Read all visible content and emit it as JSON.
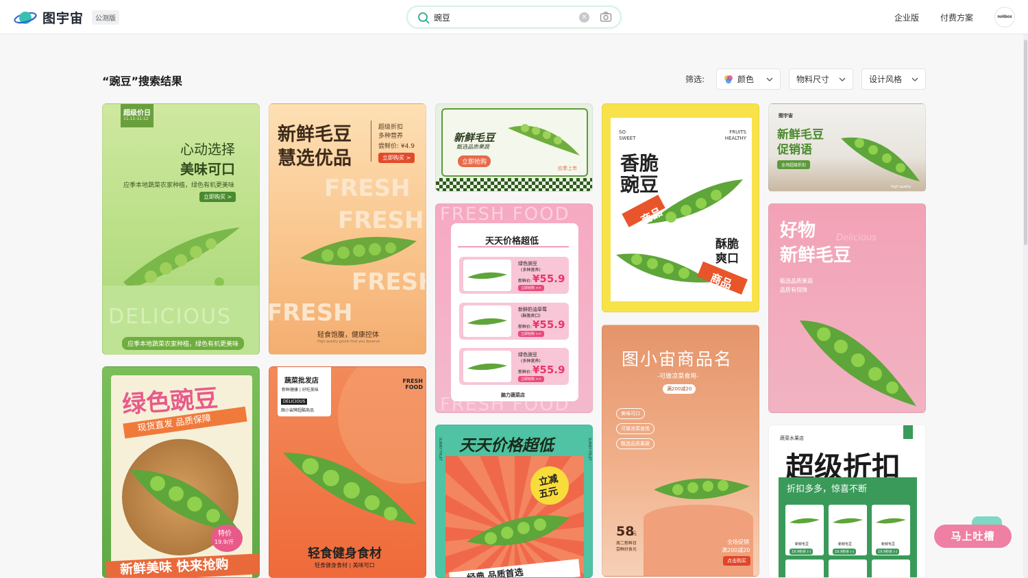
{
  "header": {
    "brand": "图宇宙",
    "edition_badge": "公测版",
    "search": {
      "value": "豌豆",
      "placeholder": ""
    },
    "nav": [
      "企业版",
      "付费方案"
    ],
    "avatar_text": "nolibox"
  },
  "results": {
    "title": "“豌豆”搜索结果",
    "filter_label": "筛选:",
    "filters": [
      "颜色",
      "物料尺寸",
      "设计风格"
    ]
  },
  "cards": {
    "c1": {
      "badge": "超级价日",
      "badge_date": "11.11-11.12",
      "title1": "心动选择",
      "title2": "美味可口",
      "desc": "应季本地蔬菜农家种植，绿色有机更美味",
      "btn": "立即购买 >",
      "watermark": "DELICIOUS",
      "footer": "应季本地蔬菜农家种植，绿色有机更美味"
    },
    "c2": {
      "title1": "新鲜毛豆",
      "title2": "慧选优品",
      "side1": "超级折扣",
      "side2": "多种营养",
      "price": "尝鲜价: ¥4.9",
      "btn": "立即购买 >",
      "fresh": "FRESH",
      "bottom": "轻食饱腹，健康控体",
      "sub": "High quality goods that you deserve."
    },
    "c3": {
      "title": "新鲜毛豆",
      "sub": "甄选品质果蔬",
      "btn": "立即抢购",
      "tag": "应季上市"
    },
    "c4": {
      "left": "SO SWEET",
      "right": "FRUITS HEALTHY",
      "title1": "香脆",
      "title2": "豌豆",
      "tag": "商品",
      "crisp1": "酥脆",
      "crisp2": "爽口",
      "tag2": "商品"
    },
    "c5": {
      "brand": "图宇宙",
      "title1": "新鲜毛豆",
      "title2": "促销语",
      "tag": "全场超级折扣",
      "hq": "high quality"
    },
    "c6": {
      "fresh": "FRESH FOOD",
      "title": "天天价格超低",
      "items": [
        {
          "name": "绿色豌豆",
          "note": "(多种营养)",
          "label": "新鲜价:",
          "price": "¥55.9",
          "btn": "立即抢购 >>"
        },
        {
          "name": "新鲜奶油草莓",
          "note": "(酥脆爽口)",
          "label": "新鲜价:",
          "price": "¥55.9",
          "btn": "立即抢购 >>"
        },
        {
          "name": "绿色豌豆",
          "note": "(多种营养)",
          "label": "新鲜价:",
          "price": "¥55.9",
          "btn": "立即抢购 >>"
        }
      ],
      "store": "脑力蔬菜店"
    },
    "c7": {
      "title1": "好物",
      "title2": "新鲜毛豆",
      "script": "Delicious",
      "desc1": "甄选品质果蔬",
      "desc2": "品质有保障"
    },
    "c8": {
      "title": "图小宙商品名",
      "sub": "-可做凉菜食用-",
      "badge": "满200减20",
      "tags": [
        "美味可口",
        "可做凉菜食用",
        "甄选品质果蔬"
      ],
      "num": "58",
      "unit": "元",
      "info1": "周二新鲜日",
      "info2": "尝鲜好食光",
      "promo1": "全场促销",
      "promo2": "满200减20",
      "btn": "点击购买"
    },
    "c9": {
      "title1": "绿色豌豆",
      "sub": "现货直发 品质保障",
      "price_label": "特价",
      "price": "19.9/斤",
      "bottom": "新鲜美味 快来抢购"
    },
    "c10": {
      "store": "蔬菜批发店",
      "tags": "新鲜健康 | 好吃美味",
      "delicious": "DELICIOUS",
      "brand": "图小宙牌超酷商品",
      "fresh": "FRESH FOOD",
      "title": "轻食健身食材",
      "sub": "轻食健身食材 | 美味可口"
    },
    "c11": {
      "side": "SUNNY FRUIT",
      "title": "天天价格超低",
      "badge1": "立减",
      "badge2": "五元",
      "bottom": "经典 品质首选"
    },
    "c12": {
      "store": "蔬菜水果店",
      "title": "超级折扣",
      "sub": "折扣多多，惊喜不断",
      "items": [
        {
          "name": "新鲜毛豆",
          "price": "19.9秒杀 (-)"
        },
        {
          "name": "新鲜毛豆",
          "price": "19.9秒杀 (-)"
        },
        {
          "name": "新鲜毛豆",
          "price": "19.9秒杀 (-)"
        }
      ]
    }
  },
  "feedback": "马上吐槽"
}
